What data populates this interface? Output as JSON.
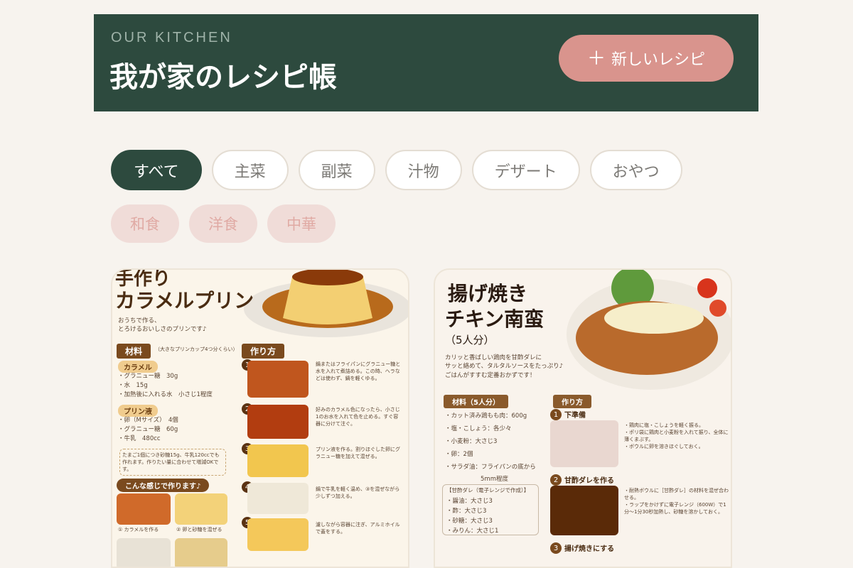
{
  "header": {
    "eyebrow": "OUR KITCHEN",
    "title": "我が家のレシピ帳",
    "new_button": "新しいレシピ"
  },
  "categories": [
    {
      "label": "すべて",
      "active": true
    },
    {
      "label": "主菜",
      "active": false
    },
    {
      "label": "副菜",
      "active": false
    },
    {
      "label": "汁物",
      "active": false
    },
    {
      "label": "デザート",
      "active": false
    },
    {
      "label": "おやつ",
      "active": false
    }
  ],
  "cuisines": [
    "和食",
    "洋食",
    "中華"
  ],
  "recipes": [
    {
      "title_line1": "手作り",
      "title_line2": "カラメルプリン",
      "lead": "おうちで作る、\nとろけるおいしさのプリンです♪",
      "ingredients_label": "材料",
      "ingredients_note": "（大きなプリンカップ4つ分くらい）",
      "caramel_label": "カラメル",
      "caramel_items": [
        "・グラニュー糖　30g",
        "・水　15g",
        "・加熱後に入れる水　小さじ1程度"
      ],
      "pudding_label": "プリン液",
      "pudding_items": [
        "・卵（Mサイズ）　4個",
        "・グラニュー糖　60g",
        "・牛乳　480cc"
      ],
      "tip": "たまご1個につき砂糖15g、牛乳120ccでも作れます。作りたい量に合わせて増減OKです。",
      "gallery_label": "こんな感じで作ります♪",
      "gallery_captions": [
        "① カラメルを作る",
        "② 卵と砂糖を混ぜる"
      ],
      "steps_label": "作り方",
      "steps": [
        "鍋またはフライパンにグラニュー糖と水を入れて煮詰める。この時、ヘラなどは使わず、鍋を軽くゆる。",
        "好みのカラメル色になったら、小さじ1のお水を入れて色を止める。すぐ容器に分けて注ぐ。",
        "プリン液を作る。割りほぐした卵にグラニュー糖を加えて混ぜる。",
        "鍋で牛乳を軽く温め、③を混ぜながら少しずつ加える。",
        "濾しながら容器に注ぎ、アルミホイルで蓋をする。"
      ]
    },
    {
      "title_line1": "揚げ焼き",
      "title_line2": "チキン南蛮",
      "servings": "（5人分）",
      "lead": "カリッと香ばしい鶏肉を甘酢ダレに\nサッと絡めて、タルタルソースをたっぷり♪\nごはんがすすむ定番おかずです！",
      "ingredients_label": "材料（5人分）",
      "ingredients": [
        "・カット済み鶏もも肉：600g",
        "・塩・こしょう：各少々",
        "・小麦粉：大さじ3",
        "・卵：2個",
        "・サラダ油：フライパンの底から",
        "5mm程度"
      ],
      "sauce_label": "【甘酢ダレ（電子レンジで作成）】",
      "sauce_items": [
        "・醤油：大さじ3",
        "・酢：大さじ3",
        "・砂糖：大さじ3",
        "・みりん：大さじ1"
      ],
      "steps_label": "作り方",
      "steps": [
        {
          "title": "下準備",
          "text": "・鶏肉に塩・こしょうを軽く振る。\n・ポリ袋に鶏肉と小麦粉を入れて振り、全体に薄くまぶす。\n・ボウルに卵を溶きほぐしておく。"
        },
        {
          "title": "甘酢ダレを作る",
          "text": "・耐熱ボウルに［甘酢ダレ］の材料を混ぜ合わせる。\n・ラップをかけずに電子レンジ（600W）で1分〜1分30秒加熱し、砂糖を溶かしておく。"
        },
        {
          "title": "揚げ焼きにする",
          "text": ""
        }
      ]
    }
  ],
  "colors": {
    "background": "#f7f3ee",
    "header": "#2d4a3e",
    "accent": "#d9948d",
    "tag": "#f0dcd8"
  }
}
